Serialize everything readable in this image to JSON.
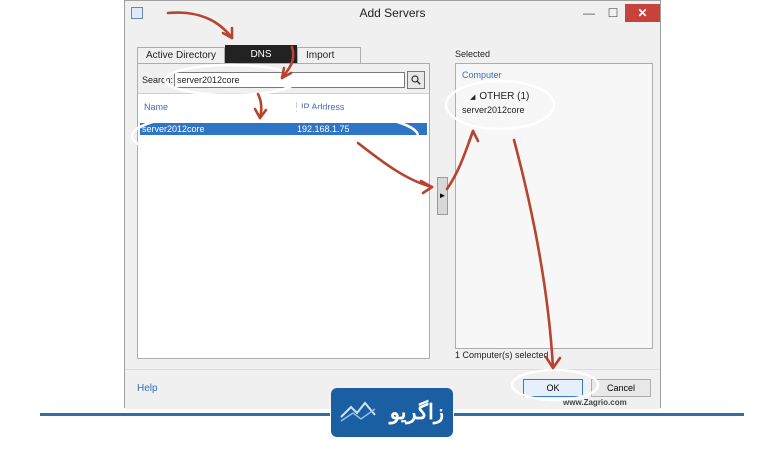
{
  "window": {
    "title": "Add Servers",
    "min_glyph": "—",
    "max_glyph": "☐",
    "close_glyph": "✕"
  },
  "tabs": [
    {
      "label": "Active Directory"
    },
    {
      "label": "DNS"
    },
    {
      "label": "Import"
    }
  ],
  "search": {
    "label": "Search:",
    "value": "server2012core",
    "button_icon": "search-icon"
  },
  "table": {
    "columns": [
      "Name",
      "IP Address"
    ],
    "rows": [
      {
        "name": "server2012core",
        "ip": "192.168.1.75"
      }
    ]
  },
  "transfer": {
    "arrow_glyph": "►"
  },
  "selected": {
    "label": "Selected",
    "column": "Computer",
    "group": "OTHER (1)",
    "group_glyph": "◢",
    "item": "server2012core",
    "count_text": "1 Computer(s) selected"
  },
  "footer": {
    "help": "Help",
    "ok": "OK",
    "cancel": "Cancel"
  },
  "watermark": "www.Zagrio.com",
  "logo": {
    "text": "زاگریو"
  },
  "colors": {
    "selection": "#2f75c7",
    "link": "#3b6fb6",
    "annotation": "#b8432f",
    "brand": "#1b5fa3"
  }
}
